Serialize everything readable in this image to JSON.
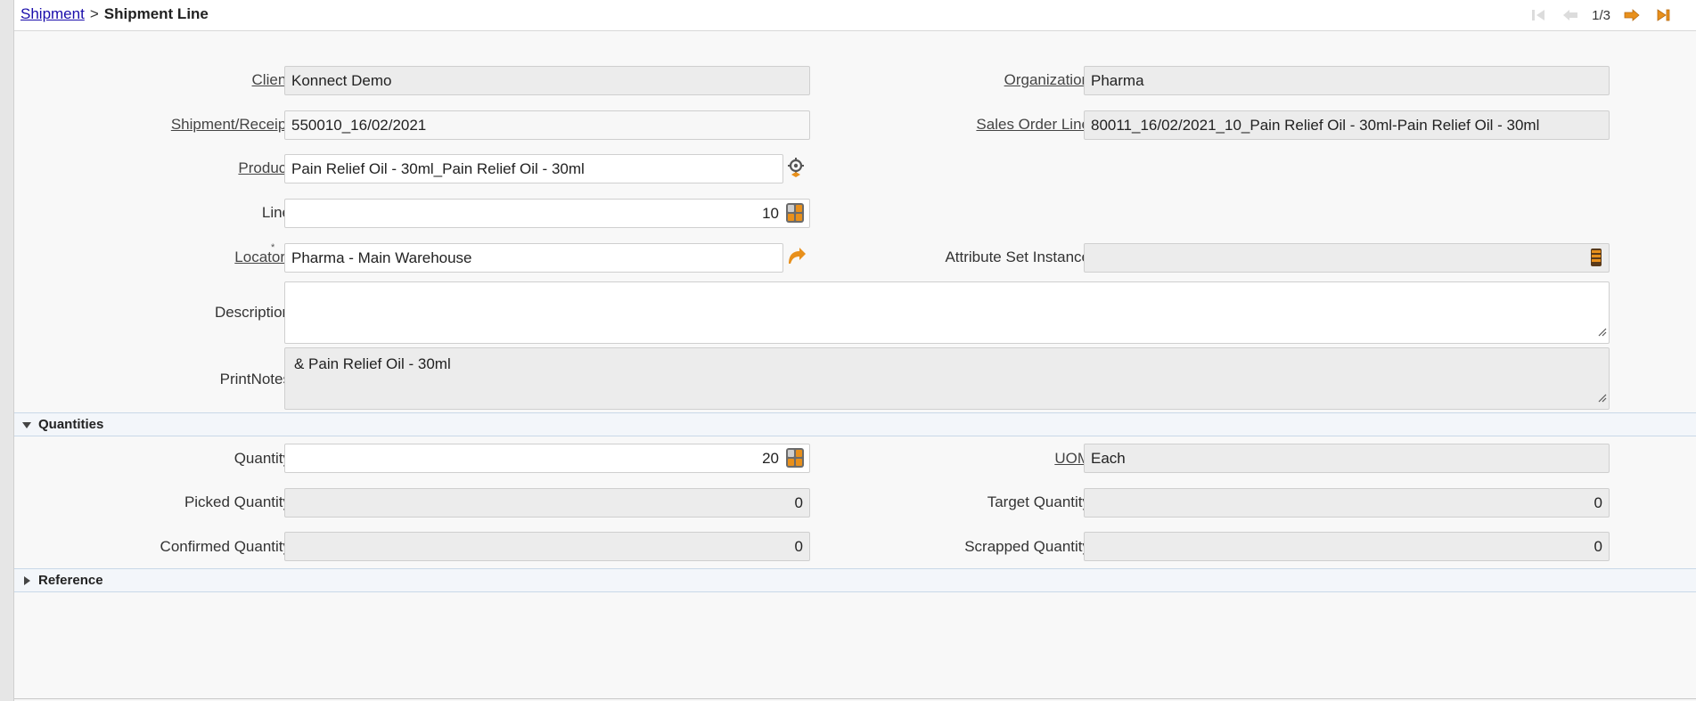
{
  "breadcrumb": {
    "parent": "Shipment",
    "separator": ">",
    "current": "Shipment Line"
  },
  "nav": {
    "counter": "1/3",
    "icons": [
      "first-record-icon",
      "previous-record-icon",
      "next-record-icon",
      "last-record-icon"
    ]
  },
  "fields": {
    "client": {
      "label": "Client",
      "value": "Konnect Demo"
    },
    "organization": {
      "label": "Organization",
      "value": "Pharma"
    },
    "shipment_receipt": {
      "label": "Shipment/Receipt",
      "value": "550010_16/02/2021"
    },
    "sales_order_line": {
      "label": "Sales Order Line",
      "value": "80011_16/02/2021_10_Pain Relief Oil - 30ml-Pain Relief Oil - 30ml"
    },
    "product": {
      "label": "Product",
      "value": "Pain Relief Oil - 30ml_Pain Relief Oil - 30ml"
    },
    "line": {
      "label": "Line",
      "value": "10"
    },
    "locator": {
      "label": "Locator",
      "mandatory_mark": "*",
      "value": "Pharma - Main Warehouse"
    },
    "attribute_set_instance": {
      "label": "Attribute Set Instance",
      "value": ""
    },
    "description": {
      "label": "Description",
      "value": ""
    },
    "print_notes": {
      "label": "PrintNotes",
      "value": "& Pain Relief Oil - 30ml"
    }
  },
  "sections": {
    "quantities": {
      "title": "Quantities",
      "expanded": true
    },
    "reference": {
      "title": "Reference",
      "expanded": false
    }
  },
  "quantities": {
    "quantity": {
      "label": "Quantity",
      "value": "20"
    },
    "uom": {
      "label": "UOM",
      "value": "Each"
    },
    "picked_quantity": {
      "label": "Picked Quantity",
      "value": "0"
    },
    "target_quantity": {
      "label": "Target Quantity",
      "value": "0"
    },
    "confirmed_quantity": {
      "label": "Confirmed Quantity",
      "value": "0"
    },
    "scrapped_quantity": {
      "label": "Scrapped Quantity",
      "value": "0"
    }
  },
  "colors": {
    "accent_orange": "#e8901c",
    "link_blue": "#1a0dab",
    "section_bg": "#f3f6fa"
  }
}
